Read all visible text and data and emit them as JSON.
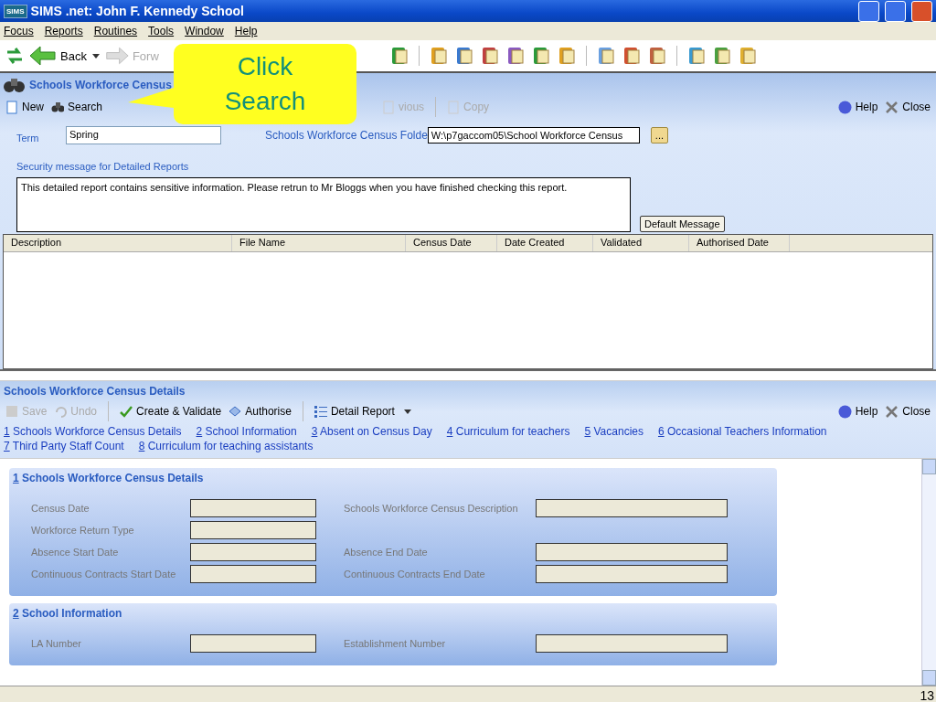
{
  "window": {
    "title": "SIMS .net: John F. Kennedy School",
    "app_badge": "SIMS"
  },
  "menu": [
    "Focus",
    "Reports",
    "Routines",
    "Tools",
    "Window",
    "Help"
  ],
  "toolbar": {
    "back": "Back",
    "forward": "Forw"
  },
  "browse_panel": {
    "title": "Schools Workforce Census",
    "buttons": [
      {
        "label": "New",
        "disabled": false
      },
      {
        "label": "Search",
        "disabled": false
      },
      {
        "label": "vious",
        "disabled": true
      },
      {
        "label": "Copy",
        "disabled": true
      }
    ],
    "help": "Help",
    "close": "Close",
    "term_label": "Term",
    "term_value": "Spring",
    "folder_label": "Schools Workforce Census Folde",
    "folder_value": "W:\\p7gaccom05\\School Workforce Census",
    "browse_button": "...",
    "security_label": "Security message for Detailed Reports",
    "security_message": "This detailed report contains sensitive information.  Please retrun to Mr Bloggs when you have finished checking this report.",
    "default_button": "Default Message",
    "table": {
      "columns": [
        "Description",
        "File Name",
        "Census Date",
        "Date Created",
        "Validated",
        "Authorised Date"
      ]
    }
  },
  "details_panel": {
    "title": "Schools Workforce Census Details",
    "buttons": [
      {
        "label": "Save",
        "disabled": true
      },
      {
        "label": "Undo",
        "disabled": true
      },
      {
        "label": "Create & Validate",
        "disabled": false
      },
      {
        "label": "Authorise",
        "disabled": false
      },
      {
        "label": "Detail Report",
        "disabled": false
      }
    ],
    "help": "Help",
    "close": "Close",
    "links": [
      {
        "key": "1",
        "label": " Schools Workforce Census Details"
      },
      {
        "key": "2",
        "label": " School Information"
      },
      {
        "key": "3",
        "label": " Absent on Census Day"
      },
      {
        "key": "4",
        "label": " Curriculum for teachers"
      },
      {
        "key": "5",
        "label": " Vacancies"
      },
      {
        "key": "6",
        "label": " Occasional Teachers Information"
      },
      {
        "key": "7",
        "label": " Third Party Staff Count"
      },
      {
        "key": "8",
        "label": " Curriculum for teaching assistants"
      }
    ],
    "sections": [
      {
        "key": "1",
        "title": " Schools Workforce Census Details",
        "rows": [
          {
            "left": "Census Date",
            "right": "Schools Workforce Census Description"
          },
          {
            "left": "Workforce Return Type"
          },
          {
            "left": "Absence Start Date",
            "right": "Absence End Date"
          },
          {
            "left": "Continuous Contracts Start Date",
            "right": "Continuous Contracts End Date"
          }
        ]
      },
      {
        "key": "2",
        "title": " School Information",
        "rows": [
          {
            "left": "LA Number",
            "right": "Establishment Number"
          }
        ]
      }
    ]
  },
  "callout": "Click Search",
  "page_number": "13"
}
